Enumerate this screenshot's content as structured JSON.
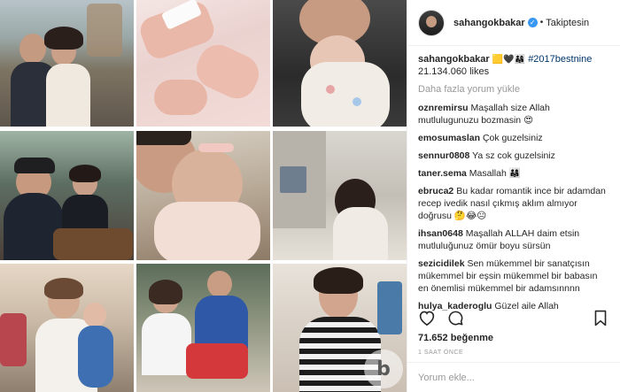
{
  "post": {
    "username": "sahangokbakar",
    "follow_status": "Takiptesin",
    "caption_user": "sahangokbakar",
    "caption_hashtag": "#2017bestnine",
    "caption_likes": "21.134.060 likes",
    "load_more": "Daha fazla yorum yükle",
    "likes": "71.652 beğenme",
    "time_ago": "1 SAAT ÖNCE",
    "add_comment_placeholder": "Yorum ekle..."
  },
  "comments": [
    {
      "user": "oznremirsu",
      "text": "Maşallah size Allah mutlulugunuzu bozmasin"
    },
    {
      "user": "emosumaslan",
      "text": "Çok guzelsiniz"
    },
    {
      "user": "sennur0808",
      "text": "Ya sz cok guzelsiniz"
    },
    {
      "user": "taner.sema",
      "text": "Masallah"
    },
    {
      "user": "ebruca2",
      "text": "Bu kadar romantik ince bir adamdan recep ivedik nasıl çıkmış aklım almıyor doğrusu"
    },
    {
      "user": "ihsan0648",
      "text": "Maşallah ALLAH daim etsin mutluluğunuz ömür boyu sürsün"
    },
    {
      "user": "sezicidilek",
      "text": "Sen mükemmel bir sanatçısın mükemmel bir eşsin mükemmel bir babasın en önemlisi mükemmel bir adamsınnnn"
    },
    {
      "user": "hulya_kaderoglu",
      "text": "Güzel aile Allah"
    }
  ],
  "watermark": "b",
  "colors": {
    "verified": "#3897f0",
    "hashtag": "#003569",
    "muted": "#999999"
  },
  "icons": [
    "heart-icon",
    "comment-icon",
    "bookmark-icon",
    "verified-icon"
  ]
}
